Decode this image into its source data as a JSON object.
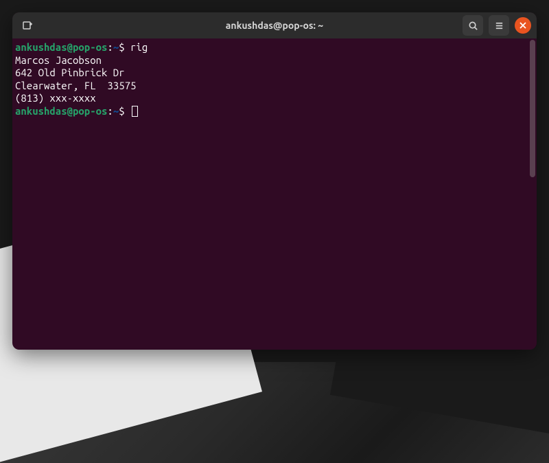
{
  "window": {
    "title": "ankushdas@pop-os: ~"
  },
  "prompt": {
    "user_host": "ankushdas@pop-os",
    "path": "~",
    "symbol": "$"
  },
  "commands": {
    "line1": {
      "cmd": "rig"
    }
  },
  "output": {
    "name": "Marcos Jacobson",
    "street": "642 Old Pinbrick Dr",
    "city_state_zip": "Clearwater, FL  33575",
    "phone": "(813) xxx-xxxx"
  }
}
